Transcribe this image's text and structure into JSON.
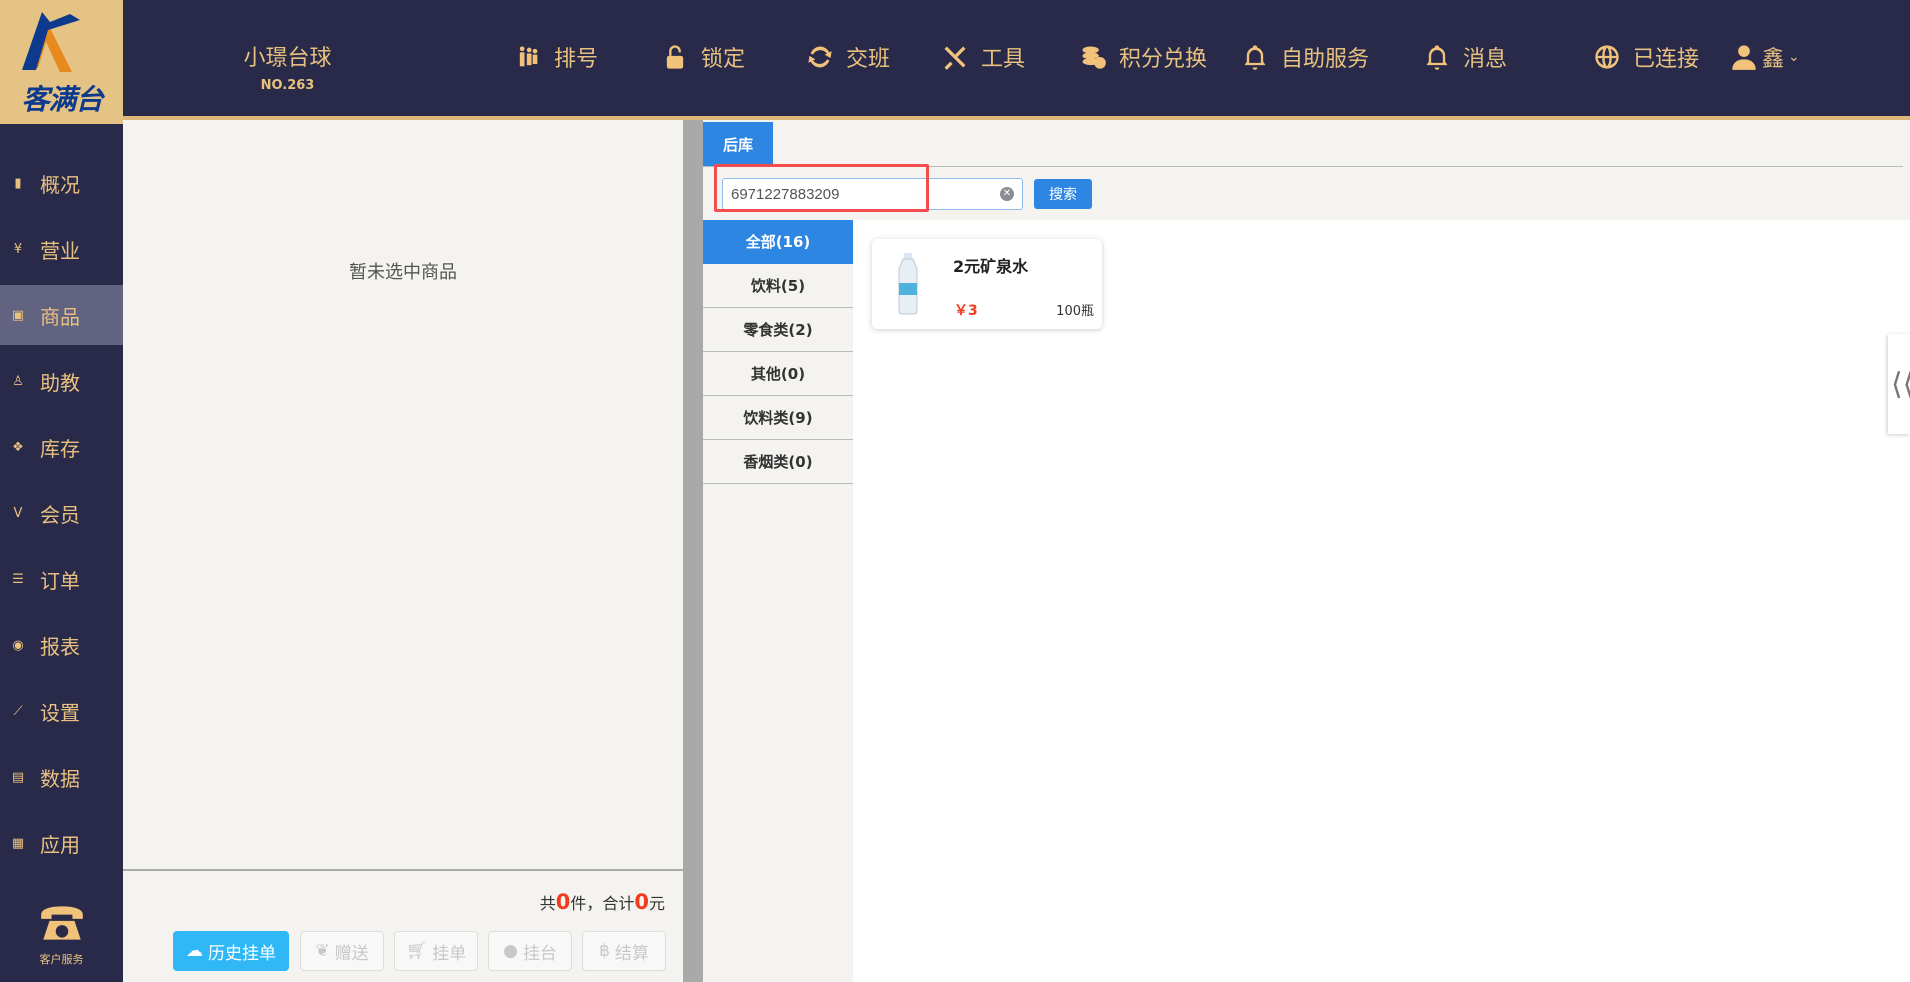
{
  "brand": {
    "logo_text": "客满台"
  },
  "shop": {
    "name": "小璟台球",
    "number": "NO.263"
  },
  "nav": [
    {
      "label": "排号",
      "icon": "people-queue-icon"
    },
    {
      "label": "锁定",
      "icon": "lock-icon"
    },
    {
      "label": "交班",
      "icon": "refresh-icon"
    },
    {
      "label": "工具",
      "icon": "tools-icon"
    },
    {
      "label": "积分兑换",
      "icon": "coins-icon"
    },
    {
      "label": "自助服务",
      "icon": "bell-icon"
    },
    {
      "label": "消息",
      "icon": "bell-icon"
    },
    {
      "label": "已连接",
      "icon": "globe-icon"
    },
    {
      "label": "鑫",
      "icon": "user-icon"
    }
  ],
  "sidebar": {
    "items": [
      {
        "label": "概况"
      },
      {
        "label": "营业"
      },
      {
        "label": "商品"
      },
      {
        "label": "助教"
      },
      {
        "label": "库存"
      },
      {
        "label": "会员"
      },
      {
        "label": "订单"
      },
      {
        "label": "报表"
      },
      {
        "label": "设置"
      },
      {
        "label": "数据"
      },
      {
        "label": "应用"
      }
    ],
    "active": "商品",
    "customer_service": "客户服务"
  },
  "cart": {
    "empty_text": "暂未选中商品",
    "summary": {
      "prefix": "共",
      "count": "0",
      "mid": "件，合计",
      "total": "0",
      "suffix": "元"
    },
    "buttons": [
      "历史挂单",
      "赠送",
      "挂单",
      "挂台",
      "结算"
    ]
  },
  "store": {
    "tab": "后库",
    "search": {
      "value": "6971227883209",
      "button": "搜索"
    },
    "categories": [
      "全部(16)",
      "饮料(5)",
      "零食类(2)",
      "其他(0)",
      "饮料类(9)",
      "香烟类(0)"
    ],
    "products": [
      {
        "name": "2元矿泉水",
        "price": "￥3",
        "stock": "100瓶"
      }
    ]
  },
  "colors": {
    "header": "#292a49",
    "gold": "#e8c17f",
    "accent": "#2d87e2",
    "price": "#f03c1e",
    "highlight": "#f24c4c"
  }
}
